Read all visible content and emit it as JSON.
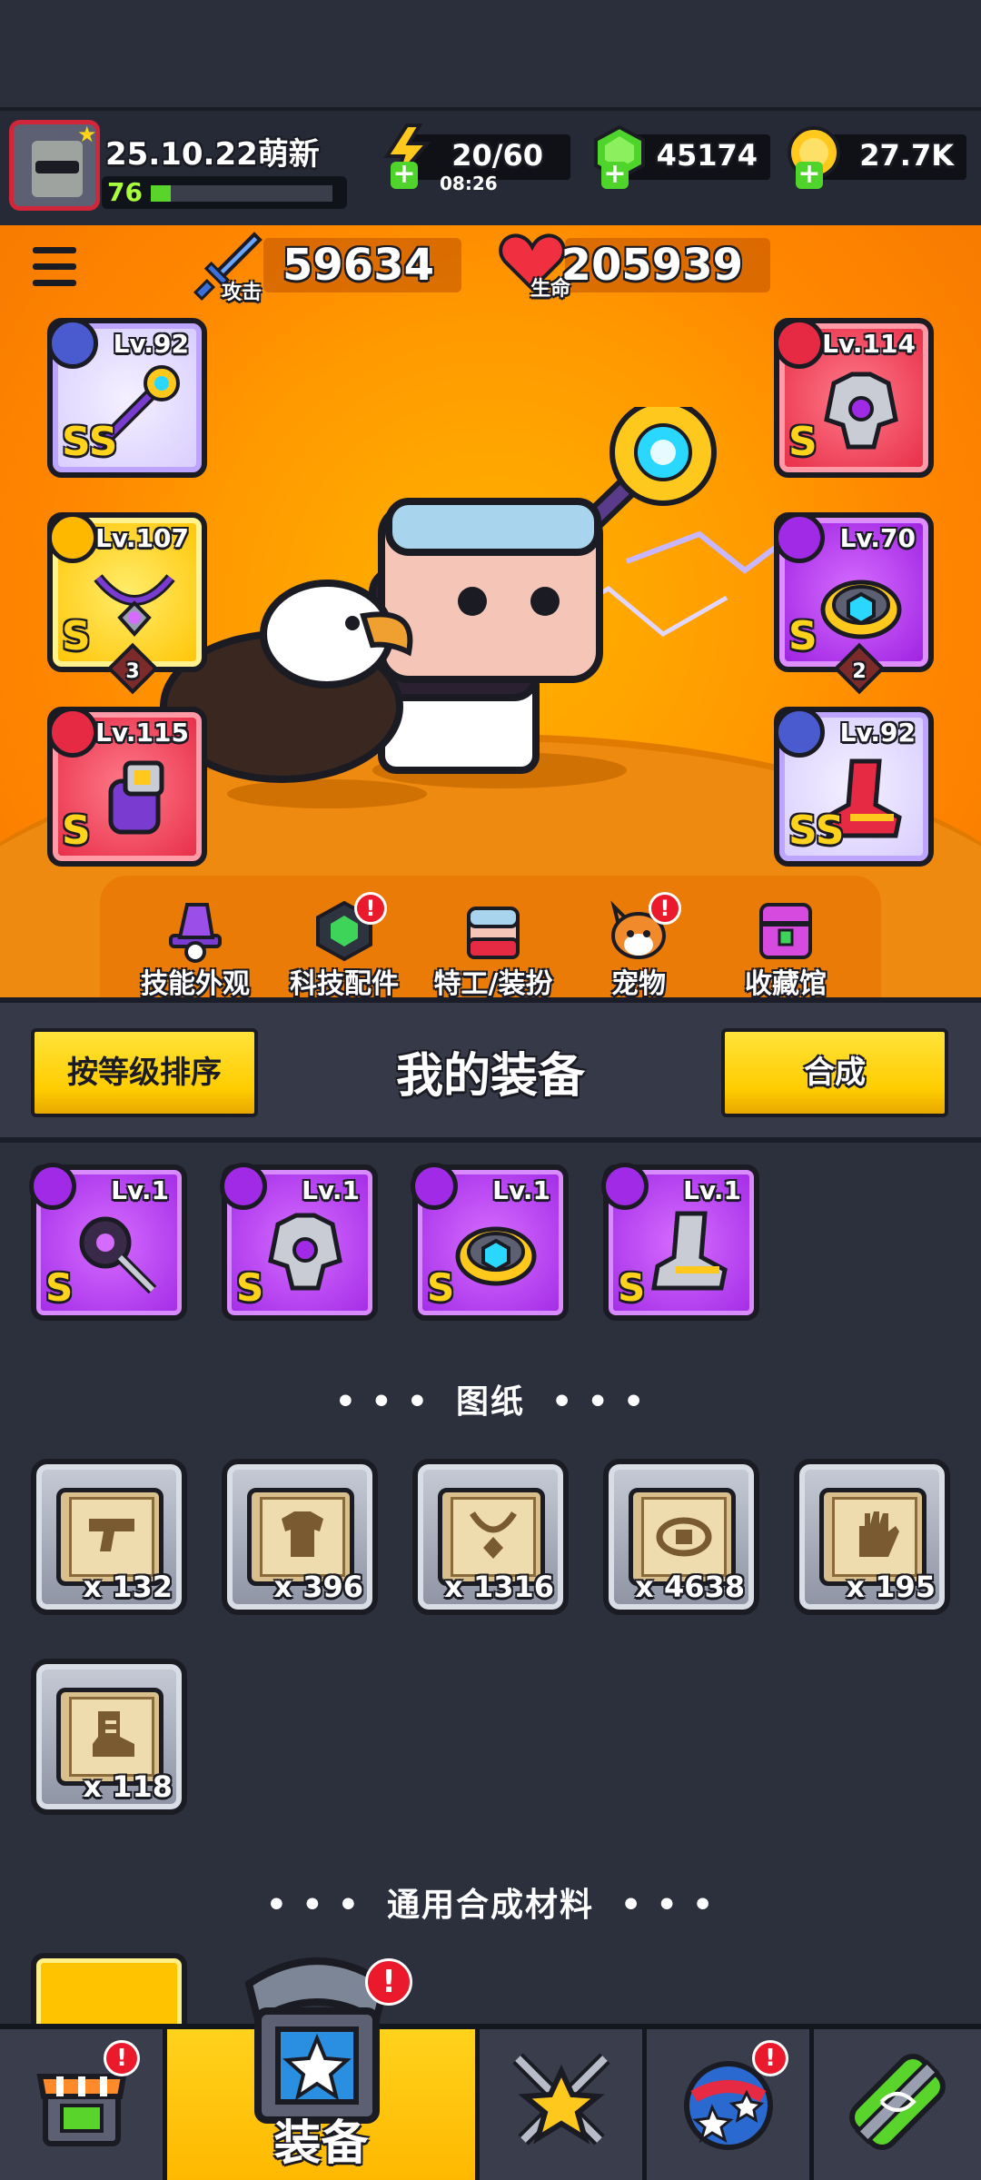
{
  "player": {
    "name": "25.10.22萌新",
    "level": "76",
    "xp_fraction": 0.11
  },
  "resources": {
    "energy": "20/60",
    "energy_timer": "08:26",
    "gems": "45174",
    "coins": "27.7K"
  },
  "stats": {
    "attack_value": "59634",
    "attack_label": "攻击",
    "hp_value": "205939",
    "hp_label": "生命"
  },
  "equipped": {
    "weapon": {
      "level": "Lv.92",
      "rank": "SS"
    },
    "armor": {
      "level": "Lv.114",
      "rank": "S"
    },
    "necklace": {
      "level": "Lv.107",
      "rank": "S",
      "stars": "3"
    },
    "belt": {
      "level": "Lv.70",
      "rank": "S",
      "stars": "2"
    },
    "gloves": {
      "level": "Lv.115",
      "rank": "S"
    },
    "boots": {
      "level": "Lv.92",
      "rank": "SS"
    }
  },
  "shortcuts": [
    {
      "label": "技能外观",
      "icon": "wizard-hat-icon",
      "badge": ""
    },
    {
      "label": "科技配件",
      "icon": "tech-part-icon",
      "badge": "!"
    },
    {
      "label": "特工/装扮",
      "icon": "agent-icon",
      "badge": ""
    },
    {
      "label": "宠物",
      "icon": "shiba-icon",
      "badge": "!"
    },
    {
      "label": "收藏馆",
      "icon": "chest-icon",
      "badge": ""
    }
  ],
  "equip_header": {
    "sort_label": "按等级排序",
    "title": "我的装备",
    "merge_label": "合成"
  },
  "inventory_items": [
    {
      "level": "Lv.1",
      "rank": "S",
      "icon": "weapon-icon"
    },
    {
      "level": "Lv.1",
      "rank": "S",
      "icon": "armor-icon"
    },
    {
      "level": "Lv.1",
      "rank": "S",
      "icon": "belt-icon"
    },
    {
      "level": "Lv.1",
      "rank": "S",
      "icon": "boots-icon"
    }
  ],
  "blueprints_title": "图纸",
  "blueprints": [
    {
      "count": "x 132",
      "icon": "weapon-blueprint-icon"
    },
    {
      "count": "x 396",
      "icon": "armor-blueprint-icon"
    },
    {
      "count": "x 1316",
      "icon": "necklace-blueprint-icon"
    },
    {
      "count": "x 4638",
      "icon": "belt-blueprint-icon"
    },
    {
      "count": "x 195",
      "icon": "glove-blueprint-icon"
    },
    {
      "count": "x 118",
      "icon": "boots-blueprint-icon"
    }
  ],
  "materials_title": "通用合成材料",
  "bottom_nav": {
    "equip_label": "装备",
    "badge": "!"
  },
  "colors": {
    "accent_yellow": "#ffcd00",
    "rank_gold": "#ffd21c",
    "purple_item": "#a12ae6",
    "badge_red": "#ea1a2c"
  }
}
